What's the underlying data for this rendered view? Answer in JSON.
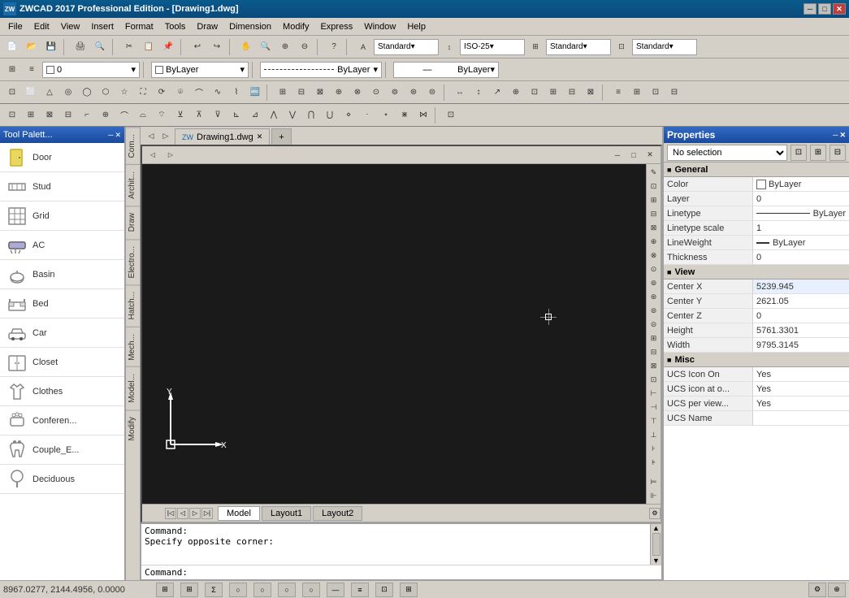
{
  "titlebar": {
    "app_name": "ZWCAD 2017 Professional Edition",
    "file_name": "[Drawing1.dwg]",
    "min_btn": "─",
    "max_btn": "□",
    "close_btn": "✕"
  },
  "menu": {
    "items": [
      "File",
      "Edit",
      "View",
      "Insert",
      "Format",
      "Tools",
      "Draw",
      "Dimension",
      "Modify",
      "Express",
      "Window",
      "Help"
    ]
  },
  "toolbar": {
    "standard_label": "Standard",
    "iso25_label": "ISO-25",
    "bylayer_label": "ByLayer"
  },
  "tool_palette": {
    "title": "Tool Palett...",
    "items": [
      {
        "label": "Door",
        "icon": "door"
      },
      {
        "label": "Stud",
        "icon": "stud"
      },
      {
        "label": "Grid",
        "icon": "grid"
      },
      {
        "label": "AC",
        "icon": "ac"
      },
      {
        "label": "Basin",
        "icon": "basin"
      },
      {
        "label": "Bed",
        "icon": "bed"
      },
      {
        "label": "Car",
        "icon": "car"
      },
      {
        "label": "Closet",
        "icon": "closet"
      },
      {
        "label": "Clothes",
        "icon": "clothes"
      },
      {
        "label": "Conferen...",
        "icon": "conference"
      },
      {
        "label": "Couple_E...",
        "icon": "couple"
      },
      {
        "label": "Deciduous",
        "icon": "deciduous"
      }
    ]
  },
  "side_tabs": [
    "Com...",
    "Archit...",
    "Draw",
    "Electro...",
    "Hatch...",
    "Mech...",
    "Model...",
    "Modify"
  ],
  "drawing": {
    "tab_name": "Drawing1.dwg",
    "model_tab": "Model",
    "layout1_tab": "Layout1",
    "layout2_tab": "Layout2"
  },
  "command": {
    "line1": "Command:",
    "line2": "Specify opposite corner:",
    "prompt": "Command:",
    "cursor_value": ""
  },
  "properties": {
    "title": "Properties",
    "selection": "No selection",
    "general_section": "General",
    "view_section": "View",
    "misc_section": "Misc",
    "rows": {
      "general": [
        {
          "label": "Color",
          "value": "ByLayer",
          "has_swatch": true
        },
        {
          "label": "Layer",
          "value": "0"
        },
        {
          "label": "Linetype",
          "value": "ByLayer"
        },
        {
          "label": "Linetype scale",
          "value": "1"
        },
        {
          "label": "LineWeight",
          "value": "ByLayer",
          "has_dash": true
        },
        {
          "label": "Thickness",
          "value": "0"
        }
      ],
      "view": [
        {
          "label": "Center X",
          "value": "5239.945"
        },
        {
          "label": "Center Y",
          "value": "2621.05"
        },
        {
          "label": "Center Z",
          "value": "0"
        },
        {
          "label": "Height",
          "value": "5761.3301"
        },
        {
          "label": "Width",
          "value": "9795.3145"
        }
      ],
      "misc": [
        {
          "label": "UCS Icon On",
          "value": "Yes"
        },
        {
          "label": "UCS icon at o...",
          "value": "Yes"
        },
        {
          "label": "UCS per view...",
          "value": "Yes"
        },
        {
          "label": "UCS Name",
          "value": ""
        }
      ]
    }
  },
  "status_bar": {
    "coords": "8967.0277, 2144.4956, 0.0000",
    "buttons": [
      "⊞",
      "⊞",
      "Σ",
      "○",
      "○",
      "○",
      "○",
      "—",
      "≡",
      "⊡",
      "⊞"
    ]
  }
}
